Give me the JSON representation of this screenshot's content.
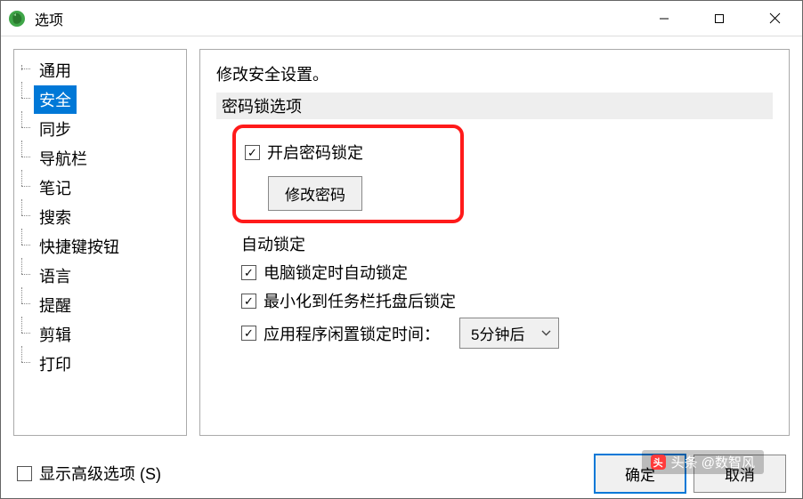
{
  "window": {
    "title": "选项"
  },
  "sidebar": {
    "items": [
      {
        "label": "通用",
        "selected": false
      },
      {
        "label": "安全",
        "selected": true
      },
      {
        "label": "同步",
        "selected": false
      },
      {
        "label": "导航栏",
        "selected": false
      },
      {
        "label": "笔记",
        "selected": false
      },
      {
        "label": "搜索",
        "selected": false
      },
      {
        "label": "快捷键按钮",
        "selected": false
      },
      {
        "label": "语言",
        "selected": false
      },
      {
        "label": "提醒",
        "selected": false
      },
      {
        "label": "剪辑",
        "selected": false
      },
      {
        "label": "打印",
        "selected": false
      }
    ]
  },
  "main": {
    "heading": "修改安全设置。",
    "section1": {
      "header": "密码锁选项",
      "enable_label": "开启密码锁定",
      "enable_checked": true,
      "change_password_label": "修改密码"
    },
    "section2": {
      "header": "自动锁定",
      "opt1": {
        "label": "电脑锁定时自动锁定",
        "checked": true
      },
      "opt2": {
        "label": "最小化到任务栏托盘后锁定",
        "checked": true
      },
      "opt3": {
        "label": "应用程序闲置锁定时间：",
        "checked": true
      },
      "idle_dropdown": "5分钟后"
    }
  },
  "footer": {
    "advanced_label": "显示高级选项 (S)",
    "advanced_checked": false,
    "ok": "确定",
    "cancel": "取消"
  },
  "watermark": {
    "text": "头条 @数智风"
  }
}
